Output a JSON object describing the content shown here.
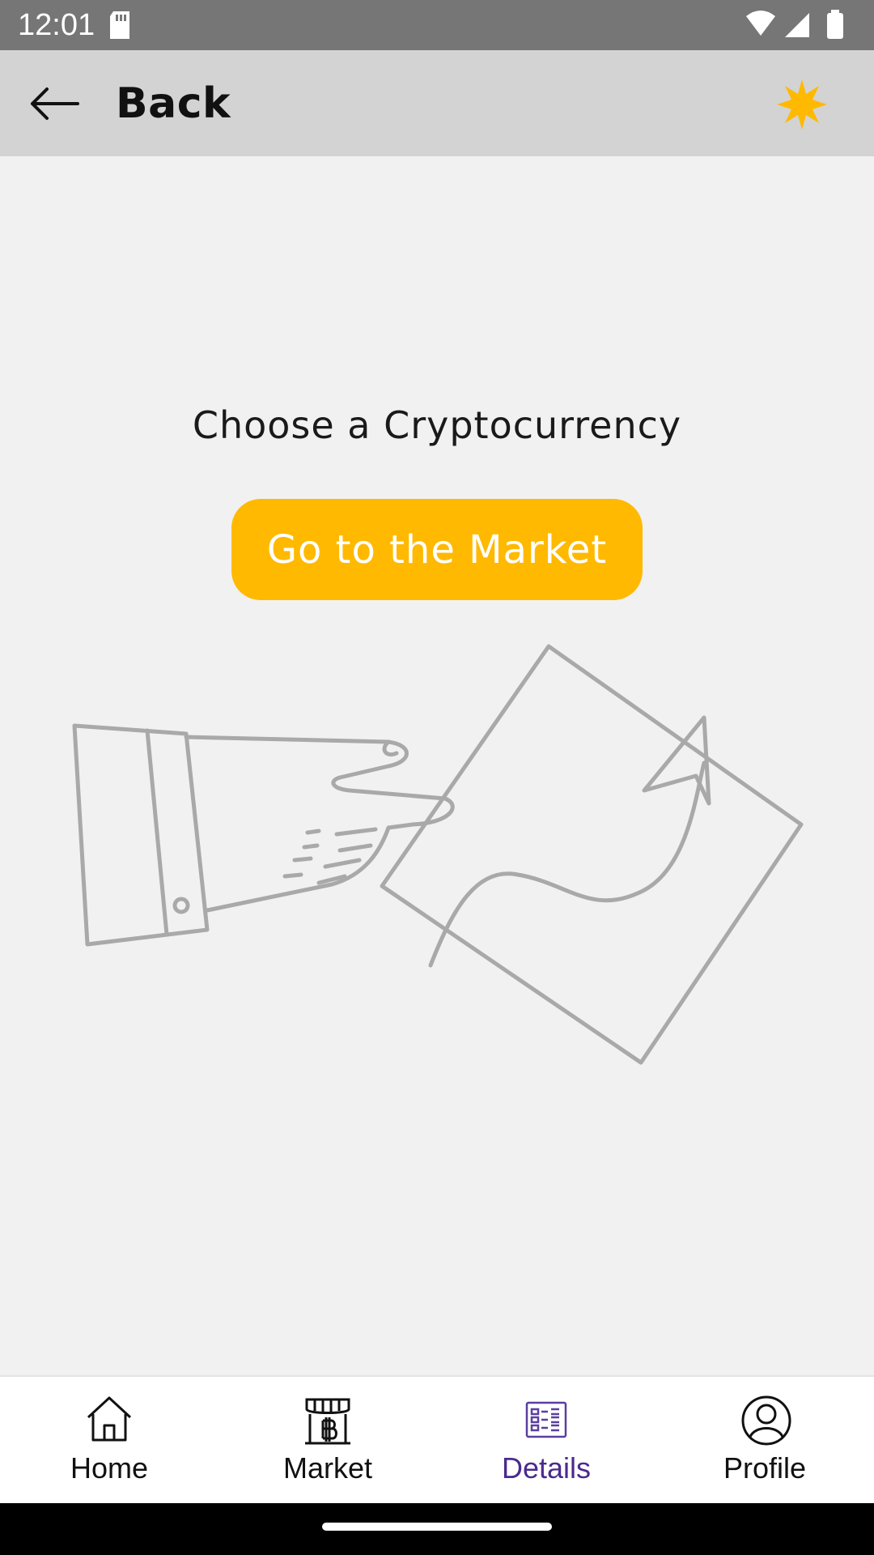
{
  "status_bar": {
    "time": "12:01"
  },
  "app_bar": {
    "title": "Back",
    "accent": "#ffb900"
  },
  "main": {
    "prompt": "Choose a Cryptocurrency",
    "button_label": "Go to the Market"
  },
  "bottom_nav": {
    "items": [
      {
        "label": "Home",
        "icon": "home-icon"
      },
      {
        "label": "Market",
        "icon": "market-icon"
      },
      {
        "label": "Details",
        "icon": "details-icon",
        "active": true
      },
      {
        "label": "Profile",
        "icon": "profile-icon"
      }
    ],
    "active_color": "#4b2a8e"
  }
}
